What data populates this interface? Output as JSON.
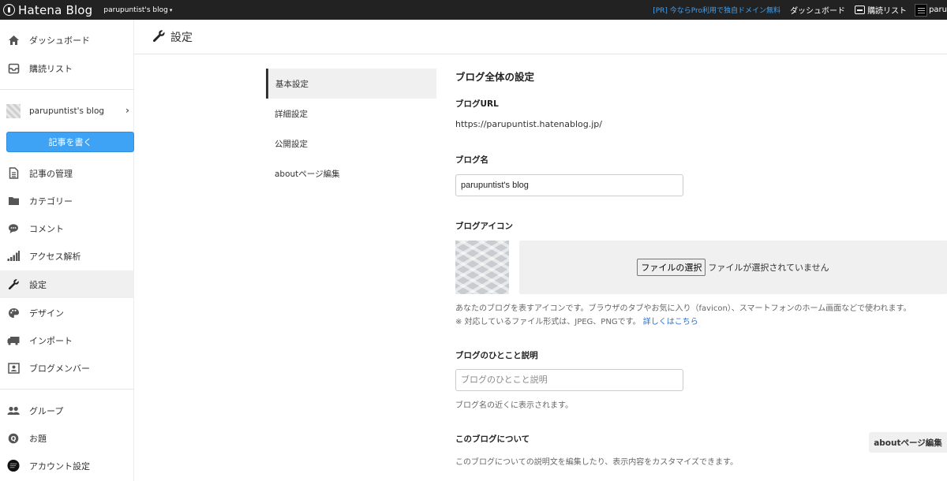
{
  "topbar": {
    "logo_text": "Hatena Blog",
    "blog_switch": "parupuntist's blog",
    "pr_link": "[PR] 今ならPro利用で独自ドメイン無料",
    "dashboard": "ダッシュボード",
    "subscriptions": "購読リスト",
    "user": "paru"
  },
  "sidebar": {
    "items": [
      {
        "label": "ダッシュボード",
        "icon": "home-icon"
      },
      {
        "label": "購読リスト",
        "icon": "subscribe-icon"
      },
      {
        "label": "記事の管理",
        "icon": "document-icon"
      },
      {
        "label": "カテゴリー",
        "icon": "folder-icon"
      },
      {
        "label": "コメント",
        "icon": "comment-icon"
      },
      {
        "label": "アクセス解析",
        "icon": "bar-chart-icon"
      },
      {
        "label": "設定",
        "icon": "wrench-icon"
      },
      {
        "label": "デザイン",
        "icon": "palette-icon"
      },
      {
        "label": "インポート",
        "icon": "truck-icon"
      },
      {
        "label": "ブログメンバー",
        "icon": "members-icon"
      },
      {
        "label": "グループ",
        "icon": "group-icon"
      },
      {
        "label": "お題",
        "icon": "q-icon"
      },
      {
        "label": "アカウント設定",
        "icon": "avatar-icon"
      }
    ],
    "blog_name": "parupuntist's blog",
    "write_button": "記事を書く"
  },
  "header": {
    "title": "設定"
  },
  "settings_nav": {
    "items": [
      "基本設定",
      "詳細設定",
      "公開設定",
      "aboutページ編集"
    ],
    "active_index": 0
  },
  "main": {
    "section_title": "ブログ全体の設定",
    "blog_url_label": "ブログURL",
    "blog_url_value": "https://parupuntist.hatenablog.jp/",
    "blog_name_label": "ブログ名",
    "blog_name_value": "parupuntist's blog",
    "blog_icon_label": "ブログアイコン",
    "file_button": "ファイルの選択",
    "file_status": "ファイルが選択されていません",
    "icon_help_1": "あなたのブログを表すアイコンです。ブラウザのタブやお気に入り（favicon）、スマートフォンのホーム画面などで使われます。",
    "icon_help_2": "※ 対応しているファイル形式は、JPEG、PNGです。",
    "icon_help_link": "詳しくはこちら",
    "description_label": "ブログのひとこと説明",
    "description_placeholder": "ブログのひとこと説明",
    "description_help": "ブログ名の近くに表示されます。",
    "about_label": "このブログについて",
    "about_help": "このブログについての説明文を編集したり、表示内容をカスタマイズできます。",
    "about_button": "aboutページ編集"
  },
  "colors": {
    "topbar_bg": "#222222",
    "accent": "#3ea3f5",
    "link": "#2a6fd0"
  }
}
